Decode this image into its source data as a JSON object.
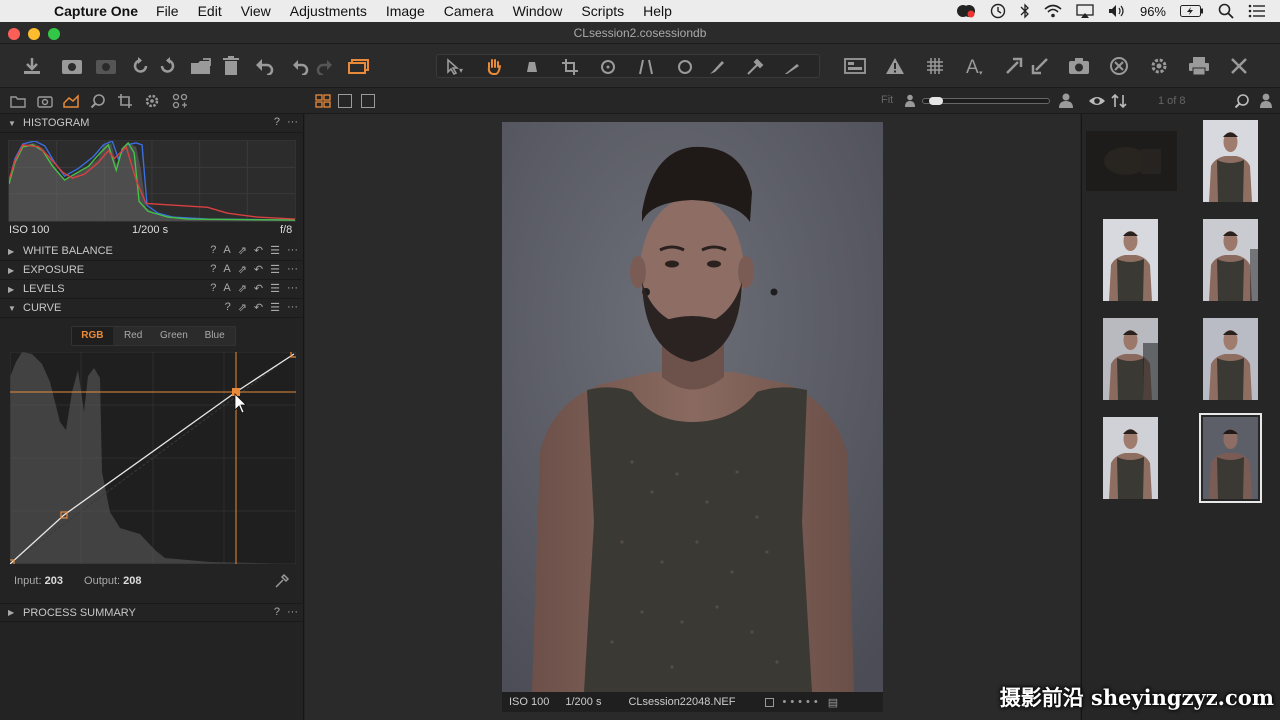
{
  "menubar": {
    "app_name": "Capture One",
    "items": [
      "File",
      "Edit",
      "View",
      "Adjustments",
      "Image",
      "Camera",
      "Window",
      "Scripts",
      "Help"
    ],
    "battery": "96%"
  },
  "window": {
    "title": "CLsession2.cosessiondb"
  },
  "viewer_header": {
    "zoom_label": "Fit"
  },
  "browser_header": {
    "count": "1 of 8"
  },
  "histogram": {
    "title": "HISTOGRAM",
    "iso": "ISO 100",
    "shutter": "1/200 s",
    "aperture": "f/8"
  },
  "tools": [
    {
      "title": "WHITE BALANCE"
    },
    {
      "title": "EXPOSURE"
    },
    {
      "title": "LEVELS"
    },
    {
      "title": "CURVE"
    }
  ],
  "curve": {
    "channels": [
      "RGB",
      "Red",
      "Green",
      "Blue"
    ],
    "active_channel": "RGB",
    "input_label": "Input:",
    "input_value": "203",
    "output_label": "Output:",
    "output_value": "208"
  },
  "process_summary": {
    "title": "PROCESS SUMMARY"
  },
  "viewer_status": {
    "iso": "ISO 100",
    "shutter": "1/200 s",
    "filename": "CLsession22048.NEF"
  },
  "colors": {
    "accent": "#e98a3a",
    "panel": "#232323"
  },
  "watermark": "摄影前沿 sheyingzyz.com"
}
